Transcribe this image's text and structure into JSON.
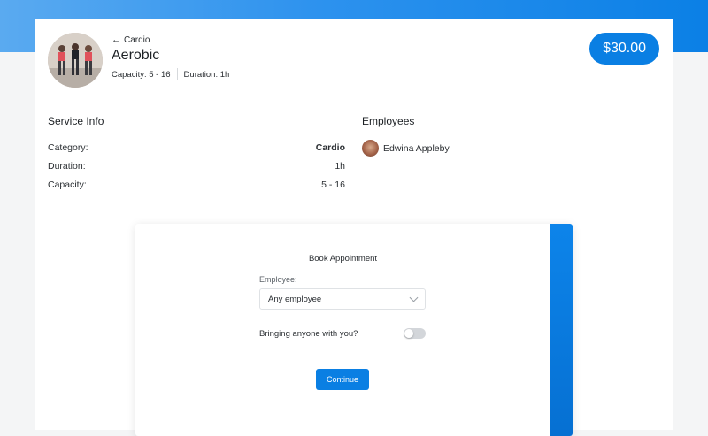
{
  "header": {
    "back_label": "Cardio",
    "title": "Aerobic",
    "capacity": "Capacity: 5 - 16",
    "duration": "Duration: 1h",
    "price": "$30.00"
  },
  "service_info": {
    "heading": "Service Info",
    "rows": [
      {
        "label": "Category:",
        "value": "Cardio"
      },
      {
        "label": "Duration:",
        "value": "1h"
      },
      {
        "label": "Capacity:",
        "value": "5 - 16"
      }
    ]
  },
  "employees": {
    "heading": "Employees",
    "items": [
      {
        "name": "Edwina Appleby"
      }
    ]
  },
  "booking": {
    "title": "Book Appointment",
    "employee_label": "Employee:",
    "employee_value": "Any employee",
    "companion_label": "Bringing anyone with you?",
    "companion_enabled": false,
    "continue_label": "Continue"
  },
  "colors": {
    "accent": "#0a7fe3",
    "background": "#f4f5f6"
  }
}
